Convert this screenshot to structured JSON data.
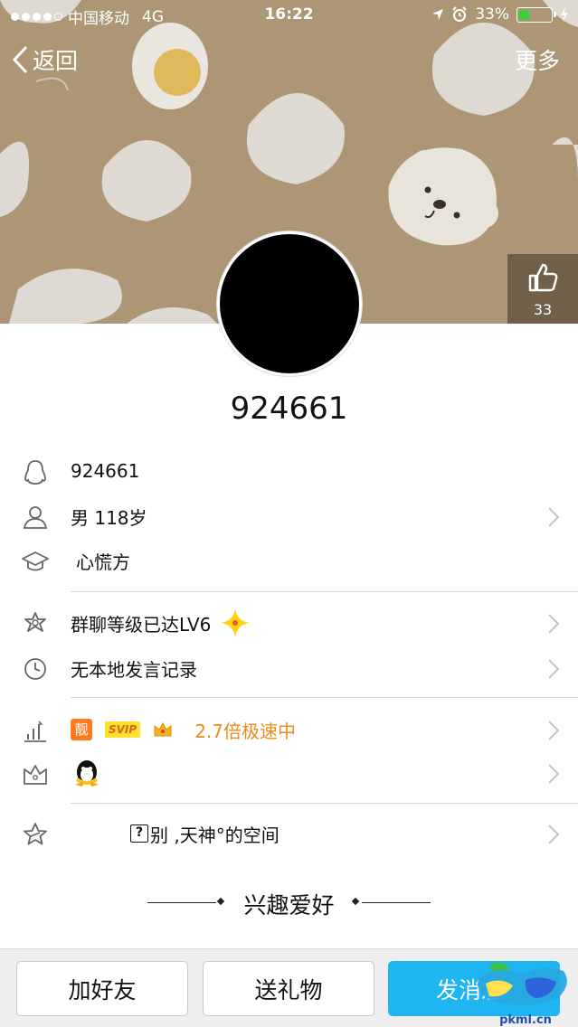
{
  "status_bar": {
    "carrier": "中国移动",
    "network": "4G",
    "time": "16:22",
    "battery_percent": "33%",
    "battery_level": 0.33
  },
  "nav": {
    "back_label": "返回",
    "more_label": "更多"
  },
  "like": {
    "count": "33"
  },
  "profile": {
    "nickname": "924661",
    "qq_number": "924661",
    "gender_age": "男 118岁",
    "school": "心慌方"
  },
  "group": {
    "level_text": "群聊等级已达LV6",
    "chat_record_text": "无本地发言记录"
  },
  "vip": {
    "liang_badge": "靓",
    "svip_badge": "SVIP",
    "speed_text": "2.7倍极速中"
  },
  "space": {
    "label_part1": "?",
    "label_part2": "别 ,天神°的空间"
  },
  "hobby": {
    "title": "兴趣爱好"
  },
  "actions": {
    "add_friend": "加好友",
    "send_gift": "送礼物",
    "send_message": "发消息"
  },
  "watermark": {
    "text": "pkml.cn"
  },
  "colors": {
    "banner": "#ad9676",
    "accent_blue": "#1eb5f1",
    "speed_orange": "#f08a1a",
    "divider": "#d8d8d8"
  }
}
